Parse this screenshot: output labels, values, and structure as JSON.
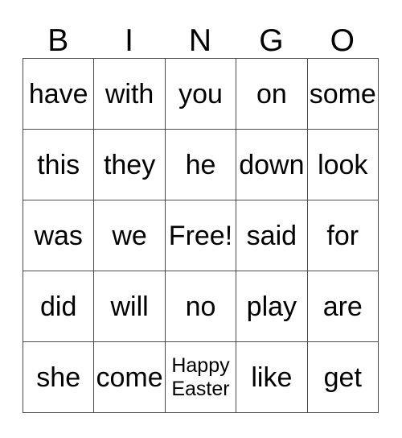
{
  "card": {
    "title_letters": [
      "B",
      "I",
      "N",
      "G",
      "O"
    ],
    "border_color": "#4a4a4a",
    "background_color": "#ffffff",
    "text_color": "#000000",
    "rows": [
      [
        {
          "text": "have",
          "free_space": false,
          "multiline": false
        },
        {
          "text": "with",
          "free_space": false,
          "multiline": false
        },
        {
          "text": "you",
          "free_space": false,
          "multiline": false
        },
        {
          "text": "on",
          "free_space": false,
          "multiline": false
        },
        {
          "text": "some",
          "free_space": false,
          "multiline": false
        }
      ],
      [
        {
          "text": "this",
          "free_space": false,
          "multiline": false
        },
        {
          "text": "they",
          "free_space": false,
          "multiline": false
        },
        {
          "text": "he",
          "free_space": false,
          "multiline": false
        },
        {
          "text": "down",
          "free_space": false,
          "multiline": false
        },
        {
          "text": "look",
          "free_space": false,
          "multiline": false
        }
      ],
      [
        {
          "text": "was",
          "free_space": false,
          "multiline": false
        },
        {
          "text": "we",
          "free_space": false,
          "multiline": false
        },
        {
          "text": "Free!",
          "free_space": true,
          "multiline": false
        },
        {
          "text": "said",
          "free_space": false,
          "multiline": false
        },
        {
          "text": "for",
          "free_space": false,
          "multiline": false
        }
      ],
      [
        {
          "text": "did",
          "free_space": false,
          "multiline": false
        },
        {
          "text": "will",
          "free_space": false,
          "multiline": false
        },
        {
          "text": "no",
          "free_space": false,
          "multiline": false
        },
        {
          "text": "play",
          "free_space": false,
          "multiline": false
        },
        {
          "text": "are",
          "free_space": false,
          "multiline": false
        }
      ],
      [
        {
          "text": "she",
          "free_space": false,
          "multiline": false
        },
        {
          "text": "come",
          "free_space": false,
          "multiline": false
        },
        {
          "text": "Happy Easter",
          "free_space": false,
          "multiline": true
        },
        {
          "text": "like",
          "free_space": false,
          "multiline": false
        },
        {
          "text": "get",
          "free_space": false,
          "multiline": false
        }
      ]
    ]
  }
}
